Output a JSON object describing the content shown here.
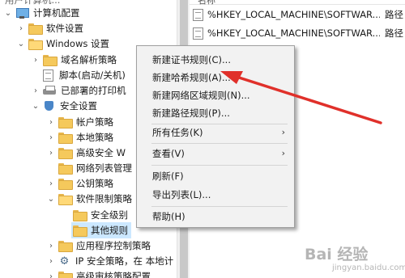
{
  "tree": {
    "items": [
      {
        "label": "计算机配置",
        "partial_top": "用户计算机..."
      },
      {
        "label": "软件设置"
      },
      {
        "label": "Windows 设置"
      },
      {
        "label": "域名解析策略"
      },
      {
        "label": "脚本(启动/关机)"
      },
      {
        "label": "已部署的打印机"
      },
      {
        "label": "安全设置"
      },
      {
        "label": "帐户策略"
      },
      {
        "label": "本地策略"
      },
      {
        "label": "高级安全 W"
      },
      {
        "label": "网络列表管理"
      },
      {
        "label": "公钥策略"
      },
      {
        "label": "软件限制策略"
      },
      {
        "label": "安全级别"
      },
      {
        "label": "其他规则"
      },
      {
        "label": "应用程序控制策略"
      },
      {
        "label": "IP 安全策略，在 本地计"
      },
      {
        "label": "高级审核策略配置"
      }
    ]
  },
  "list": {
    "header": "名称",
    "rows": [
      {
        "name": "%HKEY_LOCAL_MACHINE\\SOFTWAR...",
        "type": "路径"
      },
      {
        "name": "%HKEY_LOCAL_MACHINE\\SOFTWAR...",
        "type": "路径"
      }
    ]
  },
  "menu": {
    "items": [
      {
        "label": "新建证书规则(C)..."
      },
      {
        "label": "新建哈希规则(A)..."
      },
      {
        "label": "新建网络区域规则(N)..."
      },
      {
        "label": "新建路径规则(P)..."
      },
      {
        "label": "所有任务(K)",
        "submenu": true
      },
      {
        "label": "查看(V)",
        "submenu": true
      },
      {
        "label": "刷新(F)"
      },
      {
        "label": "导出列表(L)..."
      },
      {
        "label": "帮助(H)"
      }
    ]
  },
  "annotation": {
    "color": "#e0302a"
  },
  "icons": {
    "chevron_right": "›",
    "chevron_down": "⌄",
    "submenu_arrow": "›",
    "gear": "⚙"
  },
  "watermark": {
    "brand": "Bai 经验",
    "url": "jingyan.baidu.com"
  }
}
